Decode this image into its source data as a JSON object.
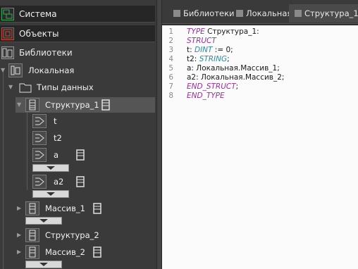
{
  "left_panel": {
    "sections": [
      {
        "label": "Система",
        "icon": "system-icon"
      },
      {
        "label": "Объекты",
        "icon": "objects-icon"
      }
    ],
    "libraries": {
      "label": "Библиотеки",
      "icon": "libraries-icon"
    },
    "tree": {
      "local": "Локальная",
      "data_types": "Типы данных",
      "struct1": "Структура_1",
      "field_t": "t",
      "field_t2": "t2",
      "field_a": "a",
      "field_a2": "a2",
      "array1": "Массив_1",
      "struct2": "Структура_2",
      "array2": "Массив_2"
    }
  },
  "tabs": [
    {
      "label": "Библиотеки",
      "active": false
    },
    {
      "label": "Локальная",
      "active": false
    },
    {
      "label": "Структура_1",
      "active": true
    }
  ],
  "editor": {
    "line_numbers": [
      "1",
      "2",
      "3",
      "4",
      "5",
      "6",
      "7",
      "8"
    ],
    "lines": {
      "l1_kw": "TYPE",
      "l1_rest": " Структура_1:",
      "l2_kw": "STRUCT",
      "l3_a": "t: ",
      "l3_ty": "DINT",
      "l3_b": " := 0;",
      "l4_a": "t2: ",
      "l4_ty": "STRING",
      "l4_b": ";",
      "l5": "a: Локальная.Массив_1;",
      "l6": "a2: Локальная.Массив_2;",
      "l7_kw": "END_STRUCT",
      "l7_b": ";",
      "l8_kw": "END_TYPE"
    }
  },
  "colors": {
    "keyword": "#9a2ea0",
    "type": "#2a8aa0",
    "system_icon": "#3aaa5a",
    "objects_icon": "#c05040"
  }
}
